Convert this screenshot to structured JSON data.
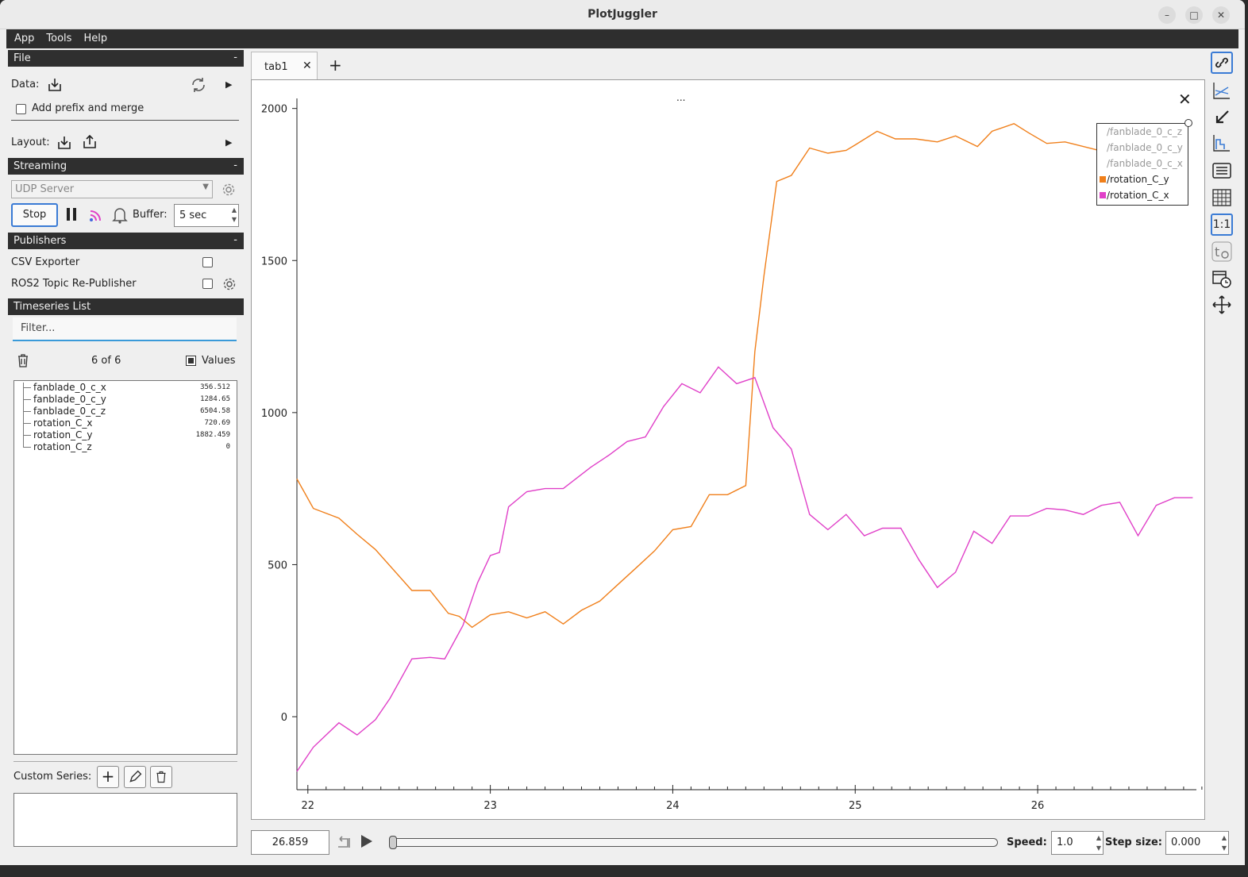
{
  "window": {
    "title": "PlotJuggler"
  },
  "menu": [
    "App",
    "Tools",
    "Help"
  ],
  "file": {
    "header": "File",
    "data_label": "Data:",
    "prefix_label": "Add prefix and merge",
    "layout_label": "Layout:"
  },
  "streaming": {
    "header": "Streaming",
    "source": "UDP Server",
    "stop_label": "Stop",
    "buffer_label": "Buffer:",
    "buffer_value": "5 sec"
  },
  "publishers": {
    "header": "Publishers",
    "items": [
      "CSV Exporter",
      "ROS2 Topic Re-Publisher"
    ]
  },
  "timeseries": {
    "header": "Timeseries List",
    "filter_placeholder": "Filter...",
    "count": "6 of 6",
    "values_label": "Values",
    "items": [
      {
        "name": "fanblade_0_c_x",
        "value": "356.512"
      },
      {
        "name": "fanblade_0_c_y",
        "value": "1284.65"
      },
      {
        "name": "fanblade_0_c_z",
        "value": "6504.58"
      },
      {
        "name": "rotation_C_x",
        "value": "720.69"
      },
      {
        "name": "rotation_C_y",
        "value": "1882.459"
      },
      {
        "name": "rotation_C_z",
        "value": "0"
      }
    ],
    "custom_label": "Custom Series:"
  },
  "tabs": {
    "active": "tab1",
    "add": "+"
  },
  "plot": {
    "title_dots": "..."
  },
  "bottom": {
    "time": "26.859",
    "speed_label": "Speed:",
    "speed_value": "1.0",
    "step_label": "Step size:",
    "step_value": "0.000"
  },
  "righttool": {
    "ratio_label": "1:1"
  },
  "chart_data": {
    "type": "line",
    "xlim": [
      21.94,
      26.87
    ],
    "ylim": [
      -240,
      2020
    ],
    "x_ticks": [
      22,
      23,
      24,
      25,
      26
    ],
    "y_ticks": [
      0,
      500,
      1000,
      1500,
      2000
    ],
    "legend": {
      "placement": "top-right",
      "entries": [
        {
          "name": "/fanblade_0_c_z",
          "active": false
        },
        {
          "name": "/fanblade_0_c_y",
          "active": false
        },
        {
          "name": "/fanblade_0_c_x",
          "active": false
        },
        {
          "name": "/rotation_C_y",
          "active": true,
          "color": "#f07f1a"
        },
        {
          "name": "/rotation_C_x",
          "active": true,
          "color": "#e040c8"
        }
      ]
    },
    "series": [
      {
        "name": "/rotation_C_y",
        "color": "#f07f1a",
        "x": [
          21.94,
          22.03,
          22.17,
          22.27,
          22.37,
          22.57,
          22.67,
          22.77,
          22.83,
          22.9,
          23.0,
          23.1,
          23.2,
          23.3,
          23.4,
          23.5,
          23.6,
          23.7,
          23.8,
          23.9,
          24.0,
          24.1,
          24.2,
          24.3,
          24.4,
          24.45,
          24.5,
          24.57,
          24.65,
          24.75,
          24.85,
          24.95,
          25.0,
          25.12,
          25.22,
          25.33,
          25.45,
          25.55,
          25.67,
          25.75,
          25.87,
          25.95,
          26.05,
          26.15,
          26.35,
          26.47,
          26.6,
          26.7,
          26.82
        ],
        "y": [
          782,
          685,
          653,
          600,
          550,
          415,
          415,
          340,
          330,
          294,
          335,
          345,
          325,
          345,
          305,
          350,
          380,
          435,
          490,
          545,
          615,
          625,
          730,
          730,
          760,
          1200,
          1450,
          1760,
          1780,
          1870,
          1853,
          1862,
          1880,
          1925,
          1900,
          1900,
          1890,
          1910,
          1875,
          1925,
          1950,
          1920,
          1885,
          1890,
          1860,
          1850,
          1870,
          1730,
          1883
        ]
      },
      {
        "name": "/rotation_C_x",
        "color": "#e040c8",
        "x": [
          21.94,
          22.03,
          22.17,
          22.27,
          22.37,
          22.45,
          22.57,
          22.67,
          22.75,
          22.85,
          22.93,
          23.0,
          23.05,
          23.1,
          23.2,
          23.3,
          23.4,
          23.55,
          23.65,
          23.75,
          23.85,
          23.95,
          24.05,
          24.15,
          24.25,
          24.35,
          24.45,
          24.55,
          24.65,
          24.75,
          24.85,
          24.95,
          25.05,
          25.15,
          25.25,
          25.35,
          25.45,
          25.55,
          25.65,
          25.75,
          25.85,
          25.95,
          26.05,
          26.15,
          26.25,
          26.35,
          26.45,
          26.55,
          26.65,
          26.75,
          26.85
        ],
        "y": [
          -180,
          -100,
          -20,
          -60,
          -10,
          60,
          190,
          195,
          190,
          300,
          440,
          530,
          540,
          690,
          740,
          750,
          750,
          820,
          860,
          905,
          920,
          1020,
          1095,
          1065,
          1150,
          1095,
          1115,
          950,
          880,
          665,
          615,
          665,
          595,
          620,
          620,
          515,
          425,
          475,
          610,
          570,
          660,
          660,
          685,
          680,
          665,
          695,
          705,
          595,
          695,
          720,
          720
        ]
      }
    ]
  }
}
